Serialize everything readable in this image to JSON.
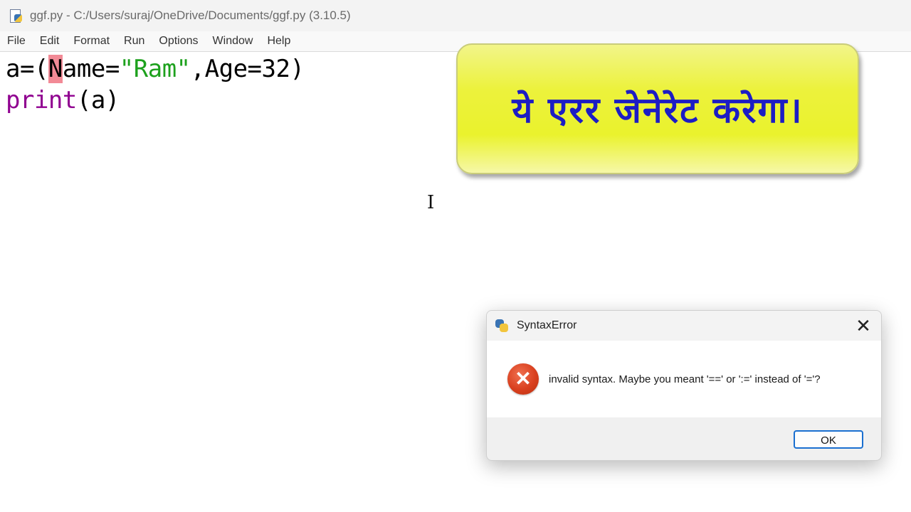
{
  "window": {
    "title": "ggf.py - C:/Users/suraj/OneDrive/Documents/ggf.py (3.10.5)",
    "icon": "python-file-icon"
  },
  "menubar": {
    "items": [
      "File",
      "Edit",
      "Format",
      "Run",
      "Options",
      "Window",
      "Help"
    ]
  },
  "editor": {
    "line1": {
      "prefix": "a=(",
      "error_char": "N",
      "after_error": "ame=",
      "string": "\"Ram\"",
      "suffix": ",Age=32)"
    },
    "line2": {
      "builtin": "print",
      "rest": "(a)"
    }
  },
  "annotation": {
    "text": "ये एरर जेनेरेट करेगा।",
    "text_color": "#1c1cc4",
    "background": "#ecf23c"
  },
  "dialog": {
    "title": "SyntaxError",
    "close_glyph": "✕",
    "error_glyph": "✕",
    "message": "invalid syntax. Maybe you meant '==' or ':=' instead of '='?",
    "ok_label": "OK",
    "error_color": "#d9401f",
    "focus_color": "#1a6fd0"
  },
  "cursor": {
    "glyph": "I"
  }
}
